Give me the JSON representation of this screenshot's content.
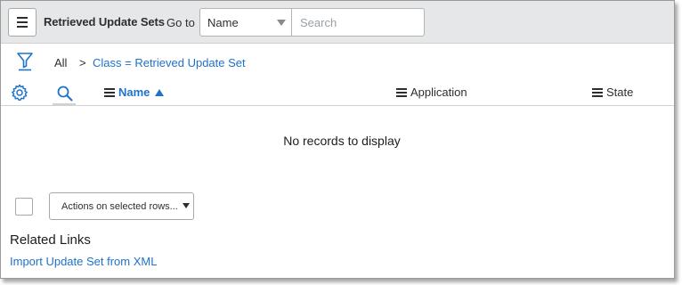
{
  "header": {
    "menu_icon": "hamburger-icon",
    "title": "Retrieved Update Sets",
    "goto_label": "Go to",
    "goto_field": "Name",
    "search_placeholder": "Search"
  },
  "breadcrumb": {
    "filter_icon": "funnel-icon",
    "all": "All",
    "separator": ">",
    "condition": "Class = Retrieved Update Set"
  },
  "columns": [
    {
      "label": "Name",
      "sorted": "ascending"
    },
    {
      "label": "Application"
    },
    {
      "label": "State"
    }
  ],
  "list": {
    "settings_icon": "gear-icon",
    "search_icon": "search-icon",
    "empty_message": "No records to display"
  },
  "actions": {
    "label": "Actions on selected rows..."
  },
  "related_links": {
    "title": "Related Links",
    "items": [
      "Import Update Set from XML"
    ]
  },
  "colors": {
    "link": "#1f72c9",
    "header_bg": "#e6e7e8"
  }
}
